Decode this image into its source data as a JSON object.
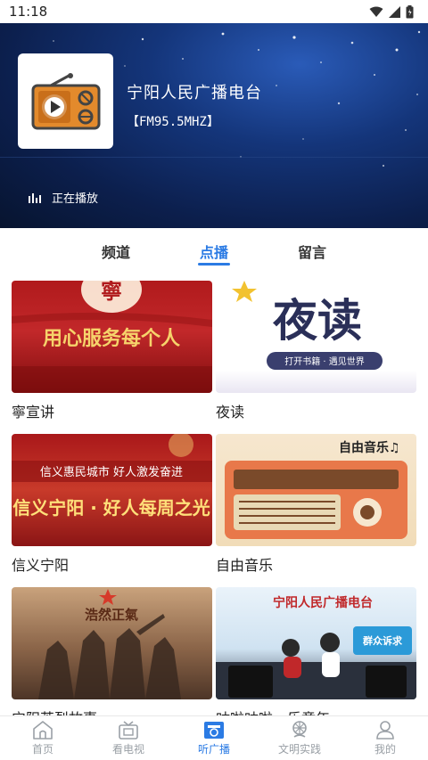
{
  "status_bar": {
    "time": "11:18"
  },
  "station": {
    "name": "宁阳人民广播电台",
    "frequency": "【FM95.5MHZ】",
    "playing_label": "正在播放"
  },
  "tabs": [
    {
      "label": "频道",
      "active": false
    },
    {
      "label": "点播",
      "active": true
    },
    {
      "label": "留言",
      "active": false
    }
  ],
  "programs": [
    {
      "title": "寧宣讲",
      "thumb_text": "用心服务每个人",
      "thumb_badge": "寧"
    },
    {
      "title": "夜读",
      "thumb_text": "夜读",
      "thumb_sub": "打开书籍 · 遇见世界"
    },
    {
      "title": "信义宁阳",
      "thumb_text": "信义宁阳 · 好人每周之光",
      "thumb_sub": "信义惠民城市  好人激发奋进"
    },
    {
      "title": "自由音乐",
      "thumb_text": "自由音乐♫"
    },
    {
      "title": "宁阳英烈故事",
      "thumb_text": "浩然正氣"
    },
    {
      "title": "咕啦咕啦，乐童年",
      "thumb_text": "宁阳人民广播电台",
      "thumb_sub": "群众诉求"
    }
  ],
  "bottom_nav": [
    {
      "label": "首页",
      "icon": "home-icon",
      "active": false
    },
    {
      "label": "看电视",
      "icon": "tv-icon",
      "active": false
    },
    {
      "label": "听广播",
      "icon": "radio-icon",
      "active": true
    },
    {
      "label": "文明实践",
      "icon": "civilization-icon",
      "active": false
    },
    {
      "label": "我的",
      "icon": "user-icon",
      "active": false
    }
  ],
  "colors": {
    "accent": "#2b7be4",
    "hero_dark": "#0c1f4d",
    "nav_inactive": "#9aa0a6"
  }
}
